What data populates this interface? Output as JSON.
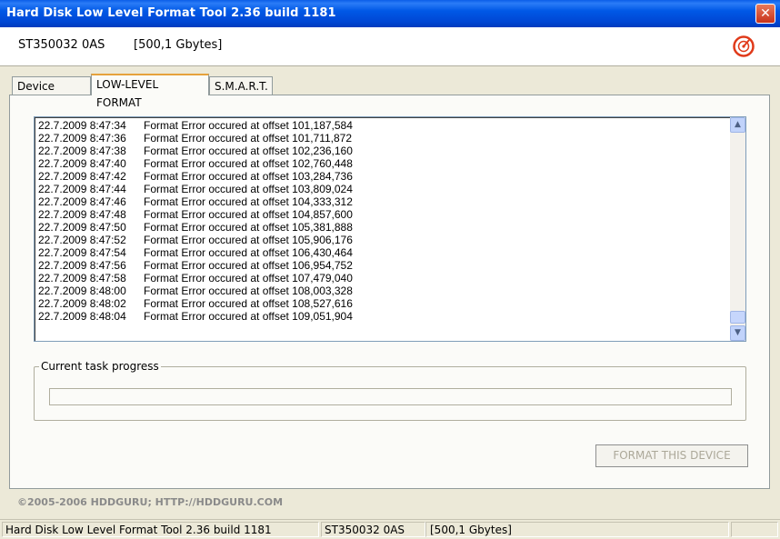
{
  "window": {
    "title": "Hard Disk Low Level Format Tool 2.36 build 1181",
    "close_label": "✕"
  },
  "header": {
    "model": "ST350032 0AS",
    "capacity": "[500,1 Gbytes]"
  },
  "tabs": [
    {
      "label": "Device details",
      "active": false
    },
    {
      "label": "LOW-LEVEL FORMAT",
      "active": true
    },
    {
      "label": "S.M.A.R.T.",
      "active": false
    }
  ],
  "log": {
    "entries": [
      {
        "timestamp": "22.7.2009 8:47:34",
        "message": "Format Error occured at offset 101,187,584"
      },
      {
        "timestamp": "22.7.2009 8:47:36",
        "message": "Format Error occured at offset 101,711,872"
      },
      {
        "timestamp": "22.7.2009 8:47:38",
        "message": "Format Error occured at offset 102,236,160"
      },
      {
        "timestamp": "22.7.2009 8:47:40",
        "message": "Format Error occured at offset 102,760,448"
      },
      {
        "timestamp": "22.7.2009 8:47:42",
        "message": "Format Error occured at offset 103,284,736"
      },
      {
        "timestamp": "22.7.2009 8:47:44",
        "message": "Format Error occured at offset 103,809,024"
      },
      {
        "timestamp": "22.7.2009 8:47:46",
        "message": "Format Error occured at offset 104,333,312"
      },
      {
        "timestamp": "22.7.2009 8:47:48",
        "message": "Format Error occured at offset 104,857,600"
      },
      {
        "timestamp": "22.7.2009 8:47:50",
        "message": "Format Error occured at offset 105,381,888"
      },
      {
        "timestamp": "22.7.2009 8:47:52",
        "message": "Format Error occured at offset 105,906,176"
      },
      {
        "timestamp": "22.7.2009 8:47:54",
        "message": "Format Error occured at offset 106,430,464"
      },
      {
        "timestamp": "22.7.2009 8:47:56",
        "message": "Format Error occured at offset 106,954,752"
      },
      {
        "timestamp": "22.7.2009 8:47:58",
        "message": "Format Error occured at offset 107,479,040"
      },
      {
        "timestamp": "22.7.2009 8:48:00",
        "message": "Format Error occured at offset 108,003,328"
      },
      {
        "timestamp": "22.7.2009 8:48:02",
        "message": "Format Error occured at offset 108,527,616"
      },
      {
        "timestamp": "22.7.2009 8:48:04",
        "message": "Format Error occured at offset 109,051,904"
      }
    ],
    "scroll_up_icon": "chevron-up-icon",
    "scroll_down_icon": "chevron-down-icon"
  },
  "progress": {
    "label": "Current task progress",
    "fraction": 0
  },
  "actions": {
    "format_button": "FORMAT THIS DEVICE",
    "format_enabled": false
  },
  "footer": {
    "copyright": "©2005-2006 HDDGURU;  HTTP://HDDGURU.COM"
  },
  "statusbar": {
    "app": "Hard Disk Low Level Format Tool 2.36 build 1181",
    "model": "ST350032 0AS",
    "capacity": "[500,1 Gbytes]"
  },
  "colors": {
    "titlebar": "#0054e3",
    "close": "#d4472a",
    "logo": "#e03a1a",
    "tab_accent": "#e6a23c"
  }
}
